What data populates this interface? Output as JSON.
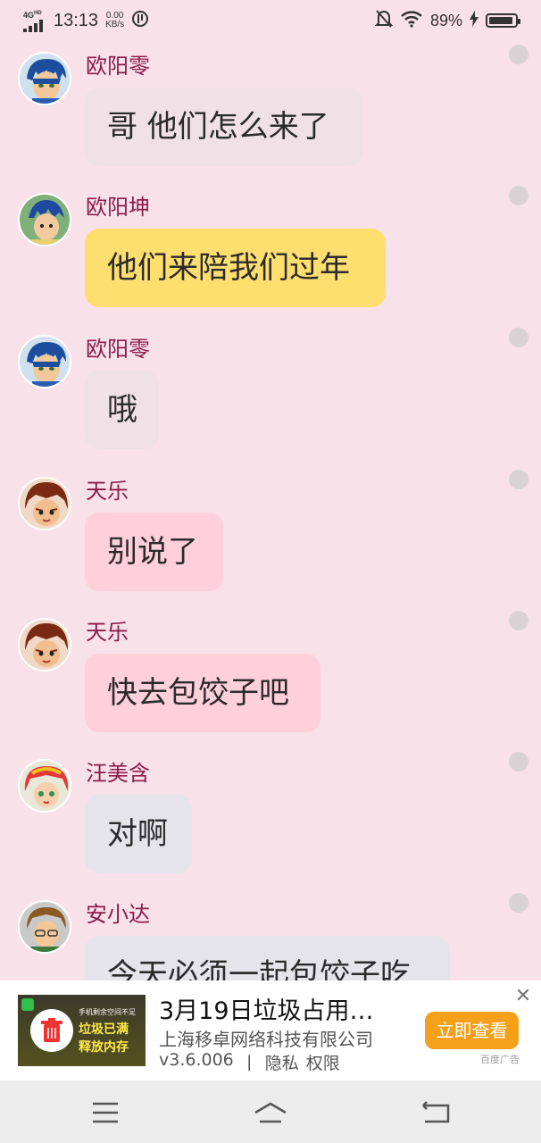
{
  "status_bar": {
    "network": "4G",
    "network_sup": "HD",
    "time": "13:13",
    "speed_value": "0.00",
    "speed_unit": "KB/s",
    "battery": "89%"
  },
  "messages": [
    {
      "name": "欧阳零",
      "text": "哥 他们怎么来了",
      "bubble_color": "#f0e1e6",
      "avatar_theme": "blue"
    },
    {
      "name": "欧阳坤",
      "text": "他们来陪我们过年",
      "bubble_color": "#ffde70",
      "avatar_theme": "green"
    },
    {
      "name": "欧阳零",
      "text": "哦",
      "bubble_color": "#f0e1e6",
      "avatar_theme": "blue"
    },
    {
      "name": "天乐",
      "text": "别说了",
      "bubble_color": "#ffcfda",
      "avatar_theme": "red"
    },
    {
      "name": "天乐",
      "text": "快去包饺子吧",
      "bubble_color": "#ffcfda",
      "avatar_theme": "red"
    },
    {
      "name": "汪美含",
      "text": "对啊",
      "bubble_color": "#e6e4eb",
      "avatar_theme": "pink"
    },
    {
      "name": "安小达",
      "text": "今天必须一起包饺子吃",
      "bubble_color": "#e6e4eb",
      "avatar_theme": "brown"
    }
  ],
  "ad": {
    "thumb_line1": "手机剩余空间不足",
    "thumb_line2": "垃圾已满",
    "thumb_line3": "释放内存",
    "title": "3月19日垃圾占用…",
    "company": "上海移卓网络科技有限公司",
    "version": "v3.6.006",
    "separator": "丨",
    "privacy": "隐私",
    "permissions": "权限",
    "button": "立即查看",
    "source_tag": "百度广告",
    "close": "✕"
  },
  "colors": {
    "background": "#f9e1e9",
    "name_color": "#8a1c4a",
    "ad_button": "#f5a01a"
  }
}
